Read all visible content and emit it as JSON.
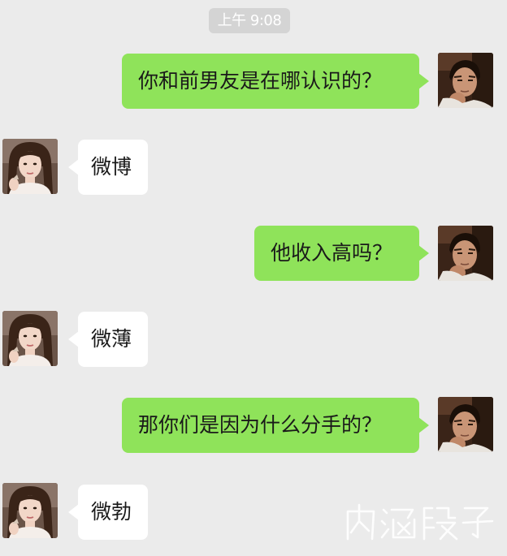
{
  "timestamp": "上午 9:08",
  "messages": [
    {
      "from": "me",
      "text": "你和前男友是在哪认识的？"
    },
    {
      "from": "her",
      "text": "微博"
    },
    {
      "from": "me",
      "text": "他收入高吗？"
    },
    {
      "from": "her",
      "text": "微薄"
    },
    {
      "from": "me",
      "text": "那你们是因为什么分手的？"
    },
    {
      "from": "her",
      "text": "微勃"
    }
  ],
  "watermark": "内涵段子",
  "colors": {
    "background": "#ebebeb",
    "sent_bubble": "#8fe35a",
    "received_bubble": "#ffffff",
    "timestamp_pill": "#d4d4d4"
  }
}
